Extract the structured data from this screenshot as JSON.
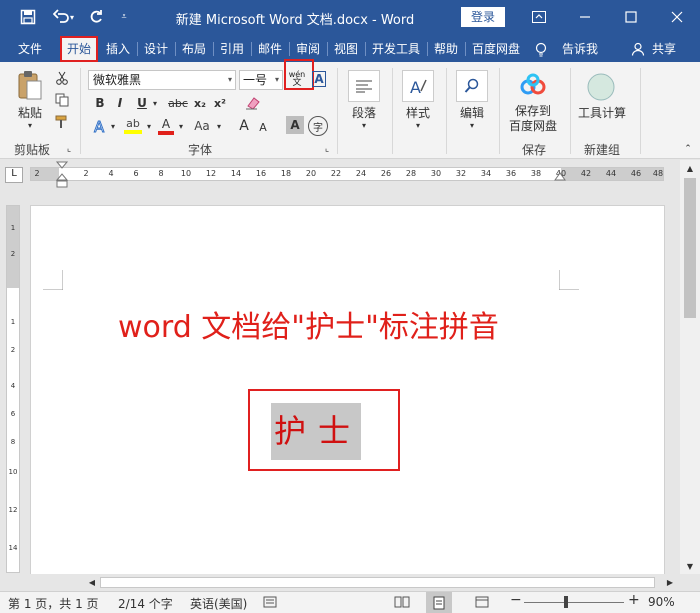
{
  "window": {
    "title": "新建 Microsoft Word 文档.docx  -  Word",
    "login_label": "登录"
  },
  "menu": {
    "tabs": [
      "文件",
      "开始",
      "插入",
      "设计",
      "布局",
      "引用",
      "邮件",
      "审阅",
      "视图",
      "开发工具",
      "帮助",
      "百度网盘"
    ],
    "active_tab": "开始",
    "tell_me": "告诉我",
    "share": "共享"
  },
  "ribbon": {
    "clipboard": {
      "paste_label": "粘贴",
      "group_label": "剪贴板"
    },
    "font": {
      "font_name": "微软雅黑",
      "font_size": "一号",
      "phonetic_guide": "wén\n文",
      "group_label": "字体",
      "bold": "B",
      "italic": "I",
      "underline": "U",
      "strike": "abc",
      "subscript": "x₂",
      "superscript": "x²",
      "grow": "A",
      "shrink": "A",
      "change_case": "Aa",
      "char_shade": "A",
      "enclose": "字"
    },
    "paragraph": {
      "label": "段落"
    },
    "styles": {
      "label": "样式"
    },
    "editing": {
      "label": "编辑"
    },
    "save": {
      "button_label": "保存到\n百度网盘",
      "group_label": "保存"
    },
    "new_group": {
      "button_label": "工具计算",
      "group_label": "新建组"
    }
  },
  "ruler": {
    "corner": "L",
    "numbers": [
      "2",
      "2",
      "4",
      "6",
      "8",
      "10",
      "12",
      "14",
      "16",
      "18",
      "20",
      "22",
      "24",
      "26",
      "28",
      "30",
      "32",
      "34",
      "36",
      "38",
      "40",
      "42",
      "44",
      "46",
      "48"
    ],
    "vertical_numbers": [
      "1",
      "2",
      "1",
      "2",
      "4",
      "6",
      "8",
      "10",
      "12",
      "14"
    ]
  },
  "document": {
    "heading": "word 文档给\"护士\"标注拼音",
    "selected_text": "护士"
  },
  "status": {
    "page": "第 1 页，共 1 页",
    "words": "2/14 个字",
    "language": "英语(美国)",
    "zoom": "90%",
    "zoom_minus": "−",
    "zoom_plus": "+"
  },
  "colors": {
    "word_blue": "#2b579a",
    "annotation_red": "#e02020",
    "doc_text_red": "#e0201a",
    "font_highlight_yellow": "#ffff00"
  }
}
